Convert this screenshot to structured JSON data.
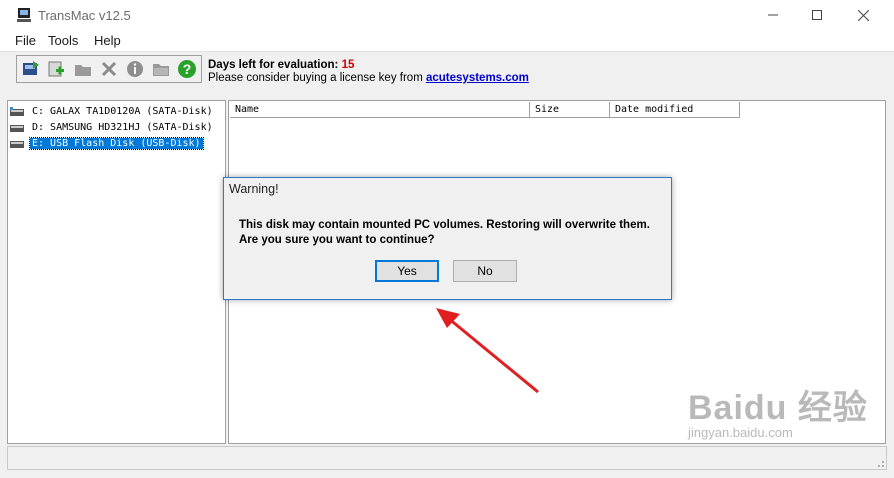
{
  "window": {
    "title": "TransMac v12.5"
  },
  "menu": {
    "items": [
      "File",
      "Tools",
      "Help"
    ]
  },
  "toolbar": {
    "icons": [
      "restore-disk-icon",
      "add-folder-icon",
      "open-folder-icon",
      "delete-icon",
      "info-icon",
      "folder-icon",
      "help-icon"
    ]
  },
  "evaluation": {
    "days_label": "Days left for evaluation:",
    "days_value": "15",
    "license_text": "Please consider buying a license key from",
    "license_link": "acutesystems.com"
  },
  "drives": [
    {
      "label": "C:  GALAX TA1D0120A (SATA-Disk)",
      "selected": false
    },
    {
      "label": "D:  SAMSUNG HD321HJ (SATA-Disk)",
      "selected": false
    },
    {
      "label": "E: USB Flash Disk (USB-Disk)",
      "selected": true
    }
  ],
  "file_list": {
    "columns": [
      "Name",
      "Size",
      "Date modified"
    ]
  },
  "dialog": {
    "title": "Warning!",
    "message_line1": "This disk may contain mounted PC volumes. Restoring will overwrite them.",
    "message_line2": "Are you sure you want to continue?",
    "yes_label": "Yes",
    "no_label": "No"
  },
  "watermark": {
    "main": "Baidu 经验",
    "sub": "jingyan.baidu.com"
  },
  "colors": {
    "selection": "#0078d7",
    "days_value": "#d00000",
    "link": "#0000cc",
    "arrow": "#e02020"
  }
}
